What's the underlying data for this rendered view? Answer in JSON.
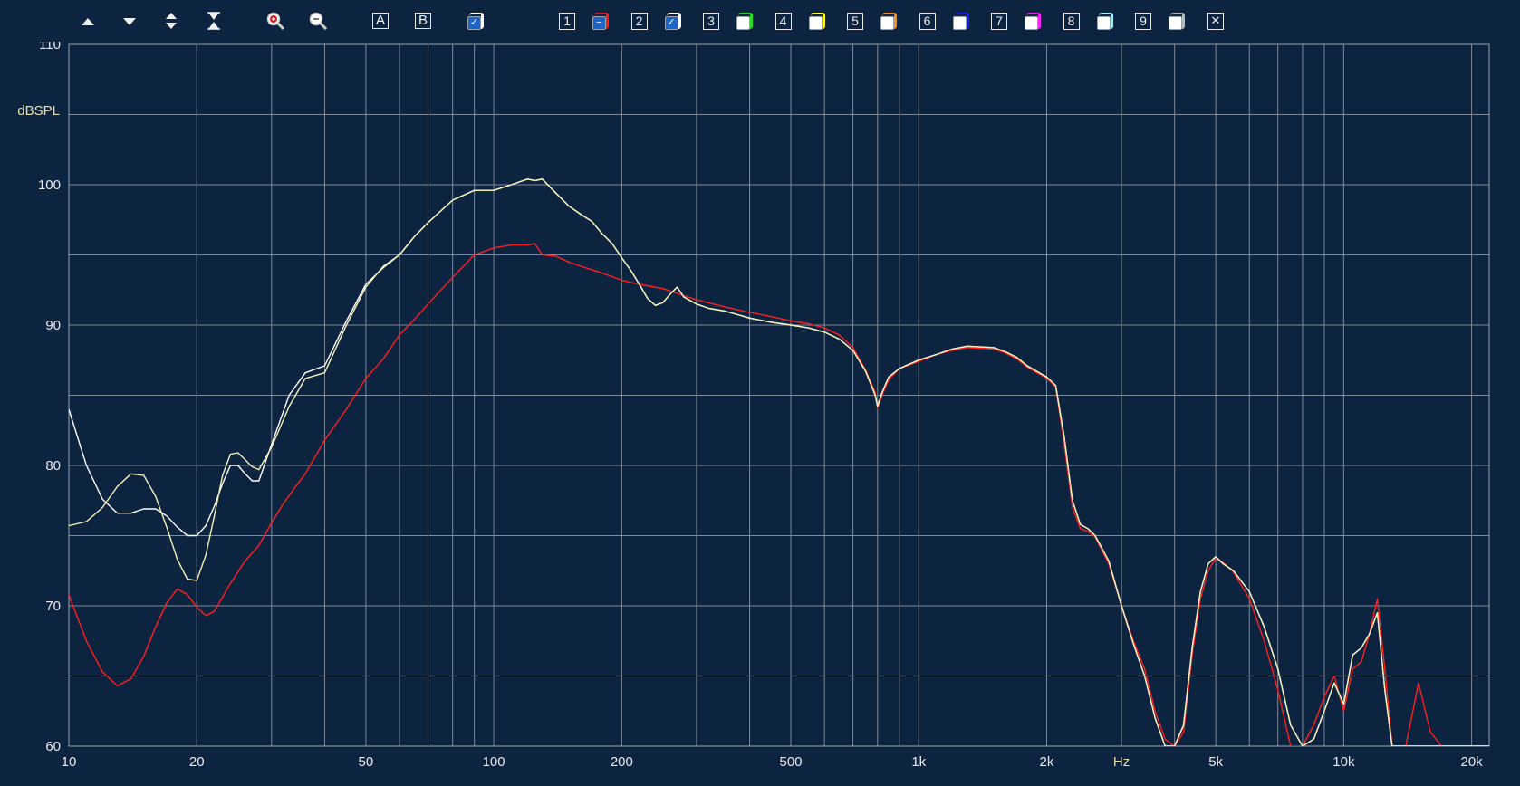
{
  "toolbar": {
    "label_a": "A",
    "label_b": "B",
    "clear_label": "✕",
    "channels": [
      {
        "num": "1",
        "color": "#ff1a1a",
        "face": "#1c64c8",
        "mark": "−"
      },
      {
        "num": "2",
        "color": "#ffffff",
        "face": "#1c64c8",
        "mark": "✓"
      },
      {
        "num": "3",
        "color": "#22e022",
        "face": "#ffffff",
        "mark": ""
      },
      {
        "num": "4",
        "color": "#ffff22",
        "face": "#ffffff",
        "mark": ""
      },
      {
        "num": "5",
        "color": "#ff8c1a",
        "face": "#ffffff",
        "mark": ""
      },
      {
        "num": "6",
        "color": "#1a1aff",
        "face": "#ffffff",
        "mark": ""
      },
      {
        "num": "7",
        "color": "#ff22ff",
        "face": "#ffffff",
        "mark": ""
      },
      {
        "num": "8",
        "color": "#a8f0f8",
        "face": "#ffffff",
        "mark": ""
      },
      {
        "num": "9",
        "color": "#b8b8b8",
        "face": "#ffffff",
        "mark": ""
      }
    ]
  },
  "chart_data": {
    "type": "line",
    "x_scale": "log",
    "xlim": [
      10,
      22000
    ],
    "ylim": [
      60,
      110
    ],
    "grid": true,
    "ylabel": "dBSPL",
    "xlabel": "Hz",
    "x_ticks": [
      {
        "value": 10,
        "label": "10"
      },
      {
        "value": 20,
        "label": "20"
      },
      {
        "value": 50,
        "label": "50"
      },
      {
        "value": 100,
        "label": "100"
      },
      {
        "value": 200,
        "label": "200"
      },
      {
        "value": 500,
        "label": "500"
      },
      {
        "value": 1000,
        "label": "1k"
      },
      {
        "value": 2000,
        "label": "2k"
      },
      {
        "value": 5000,
        "label": "5k"
      },
      {
        "value": 10000,
        "label": "10k"
      },
      {
        "value": 20000,
        "label": "20k"
      }
    ],
    "y_ticks": [
      {
        "value": 110,
        "label": "110"
      },
      {
        "value": 100,
        "label": "100"
      },
      {
        "value": 90,
        "label": "90"
      },
      {
        "value": 80,
        "label": "80"
      },
      {
        "value": 70,
        "label": "70"
      },
      {
        "value": 60,
        "label": "60"
      }
    ],
    "colors": {
      "background": "#0d2440",
      "grid": "#7e8a99",
      "tick_text": "#eaeaea",
      "ylabel": "#e8e1a8"
    },
    "series": [
      {
        "color": "#ff2020",
        "x": [
          10,
          11,
          12,
          13,
          14,
          15,
          16,
          17,
          18,
          19,
          20,
          21,
          22,
          24,
          26,
          28,
          30,
          32,
          34,
          36,
          40,
          45,
          50,
          55,
          60,
          65,
          70,
          80,
          90,
          100,
          110,
          120,
          125,
          130,
          140,
          150,
          160,
          180,
          200,
          220,
          250,
          280,
          300,
          350,
          400,
          450,
          500,
          550,
          600,
          650,
          700,
          750,
          790,
          800,
          820,
          850,
          900,
          1000,
          1100,
          1200,
          1300,
          1500,
          1600,
          1700,
          1800,
          2000,
          2100,
          2200,
          2300,
          2400,
          2500,
          2600,
          2800,
          3000,
          3200,
          3400,
          3600,
          3800,
          4000,
          4200,
          4400,
          4600,
          4800,
          5000,
          5200,
          5500,
          6000,
          6500,
          7000,
          7500,
          8000,
          8500,
          9000,
          9500,
          10000,
          10500,
          11000,
          11500,
          12000,
          12500,
          13000,
          13500,
          14000,
          15000,
          16000,
          17000,
          18000,
          19000,
          20000,
          21000,
          22000
        ],
        "y": [
          70.8,
          67.5,
          65.3,
          64.3,
          64.8,
          66.4,
          68.5,
          70.2,
          71.2,
          70.8,
          69.9,
          69.3,
          69.6,
          71.6,
          73.2,
          74.3,
          75.9,
          77.3,
          78.4,
          79.4,
          81.8,
          84.0,
          86.2,
          87.6,
          89.3,
          90.4,
          91.5,
          93.4,
          95.0,
          95.5,
          95.7,
          95.7,
          95.8,
          95.0,
          94.9,
          94.5,
          94.2,
          93.7,
          93.2,
          92.9,
          92.6,
          92.1,
          91.8,
          91.3,
          90.9,
          90.6,
          90.3,
          90.1,
          89.8,
          89.3,
          88.4,
          86.8,
          85.2,
          84.1,
          85.0,
          86.1,
          86.9,
          87.4,
          87.9,
          88.2,
          88.4,
          88.3,
          88.0,
          87.6,
          87.0,
          86.2,
          85.6,
          81.5,
          77.0,
          75.5,
          75.3,
          74.9,
          73.0,
          70.0,
          67.5,
          65.5,
          62.5,
          60.5,
          60.0,
          61.0,
          66.5,
          70.5,
          72.5,
          73.4,
          73.1,
          72.4,
          70.5,
          67.5,
          64.0,
          60.0,
          60.0,
          61.5,
          63.5,
          65.0,
          62.5,
          65.5,
          66.0,
          68.0,
          70.5,
          65.5,
          60.0,
          60.0,
          60.0,
          64.5,
          61.0,
          60.0,
          60.0,
          60.0,
          60.0,
          60.0,
          60.0
        ]
      },
      {
        "color": "#ffffff",
        "x": [
          10,
          11,
          12,
          13,
          14,
          15,
          16,
          17,
          18,
          19,
          20,
          21,
          22,
          23,
          24,
          25,
          26,
          27,
          28,
          30,
          33,
          36,
          40,
          45,
          50,
          55,
          60,
          65,
          70,
          80,
          90,
          100,
          110,
          120,
          125,
          130,
          140,
          150,
          160,
          170,
          180,
          190,
          200,
          210,
          220,
          230,
          240,
          250,
          260,
          270,
          280,
          300,
          320,
          350,
          400,
          450,
          500,
          550,
          600,
          650,
          700,
          750,
          790,
          800,
          820,
          850,
          900,
          1000,
          1100,
          1200,
          1300,
          1500,
          1600,
          1700,
          1800,
          2000,
          2100,
          2200,
          2300,
          2400,
          2500,
          2600,
          2800,
          3000,
          3200,
          3400,
          3600,
          3800,
          4000,
          4200,
          4400,
          4600,
          4800,
          5000,
          5200,
          5500,
          6000,
          6500,
          7000,
          7500,
          8000,
          8500,
          9000,
          9500,
          10000,
          10500,
          11000,
          11500,
          12000,
          12500,
          13000,
          13500,
          14000,
          15000,
          16000,
          17000,
          18000,
          19000,
          20000,
          21000,
          22000
        ],
        "y": [
          84.0,
          80.0,
          77.6,
          76.6,
          76.6,
          76.9,
          76.9,
          76.4,
          75.6,
          75.0,
          75.0,
          75.7,
          77.1,
          78.7,
          80.0,
          80.0,
          79.4,
          78.9,
          78.9,
          81.5,
          85.0,
          86.6,
          87.1,
          90.3,
          92.9,
          94.1,
          95.0,
          96.3,
          97.3,
          98.9,
          99.6,
          99.6,
          100.0,
          100.4,
          100.3,
          100.4,
          99.4,
          98.5,
          97.9,
          97.4,
          96.5,
          95.8,
          94.8,
          93.9,
          92.9,
          91.9,
          91.4,
          91.6,
          92.2,
          92.7,
          92.0,
          91.5,
          91.2,
          91.0,
          90.5,
          90.2,
          90.0,
          89.8,
          89.5,
          89.0,
          88.2,
          86.7,
          85.0,
          84.2,
          85.2,
          86.3,
          86.9,
          87.5,
          87.9,
          88.3,
          88.5,
          88.4,
          88.1,
          87.7,
          87.1,
          86.3,
          85.7,
          82.0,
          77.5,
          75.8,
          75.5,
          75.0,
          73.2,
          70.0,
          67.3,
          65.0,
          62.0,
          60.0,
          60.0,
          61.5,
          67.0,
          71.0,
          73.0,
          73.5,
          73.0,
          72.5,
          71.0,
          68.5,
          65.5,
          61.5,
          60.0,
          60.5,
          62.5,
          64.5,
          63.0,
          66.5,
          67.0,
          68.0,
          69.5,
          64.0,
          60.0,
          60.0,
          60.0,
          60.0,
          60.0,
          60.0,
          60.0,
          60.0,
          60.0,
          60.0,
          60.0
        ]
      },
      {
        "color": "#f5f0b8",
        "x": [
          10,
          11,
          12,
          13,
          14,
          15,
          16,
          17,
          18,
          19,
          20,
          21,
          22,
          23,
          24,
          25,
          26,
          27,
          28,
          30,
          33,
          36,
          40,
          45,
          50,
          55,
          60,
          65,
          70,
          80,
          90,
          100,
          110,
          120,
          125,
          130,
          140,
          150,
          160,
          170,
          180,
          190,
          200,
          210,
          220,
          230,
          240,
          250,
          260,
          270,
          280,
          300,
          320,
          350,
          400,
          450,
          500,
          550,
          600,
          650,
          700,
          750,
          790,
          800,
          820,
          850,
          900,
          1000,
          1100,
          1200,
          1300,
          1500,
          1600,
          1700,
          1800,
          2000,
          2100,
          2200,
          2300,
          2400,
          2500,
          2600,
          2800,
          3000,
          3200,
          3400,
          3600,
          3800,
          4000,
          4200,
          4400,
          4600,
          4800,
          5000,
          5200,
          5500,
          6000,
          6500,
          7000,
          7500,
          8000,
          8500,
          9000,
          9500,
          10000,
          10500,
          11000,
          11500,
          12000,
          12500,
          13000,
          13500,
          14000,
          15000,
          16000,
          17000,
          18000,
          19000,
          20000,
          21000,
          22000
        ],
        "y": [
          75.7,
          76.0,
          77.0,
          78.5,
          79.4,
          79.3,
          77.8,
          75.6,
          73.3,
          71.9,
          71.8,
          73.6,
          76.4,
          79.3,
          80.8,
          80.9,
          80.4,
          79.9,
          79.7,
          81.3,
          84.2,
          86.2,
          86.6,
          90.0,
          92.7,
          94.2,
          95.0,
          96.3,
          97.3,
          98.9,
          99.6,
          99.6,
          100.0,
          100.4,
          100.3,
          100.4,
          99.4,
          98.5,
          97.9,
          97.4,
          96.5,
          95.8,
          94.8,
          93.9,
          92.9,
          91.9,
          91.4,
          91.6,
          92.2,
          92.7,
          92.0,
          91.5,
          91.2,
          91.0,
          90.5,
          90.2,
          90.0,
          89.8,
          89.5,
          89.0,
          88.2,
          86.7,
          85.0,
          84.2,
          85.2,
          86.3,
          86.9,
          87.5,
          87.9,
          88.3,
          88.5,
          88.4,
          88.1,
          87.7,
          87.1,
          86.3,
          85.7,
          82.0,
          77.5,
          75.8,
          75.5,
          75.0,
          73.2,
          70.0,
          67.3,
          65.0,
          62.0,
          60.0,
          60.0,
          61.5,
          67.0,
          71.0,
          73.0,
          73.5,
          73.0,
          72.5,
          71.0,
          68.5,
          65.5,
          61.5,
          60.0,
          60.5,
          62.5,
          64.5,
          63.0,
          66.5,
          67.0,
          68.0,
          69.5,
          64.0,
          60.0,
          60.0,
          60.0,
          60.0,
          60.0,
          60.0,
          60.0,
          60.0,
          60.0,
          60.0,
          60.0
        ]
      }
    ]
  }
}
